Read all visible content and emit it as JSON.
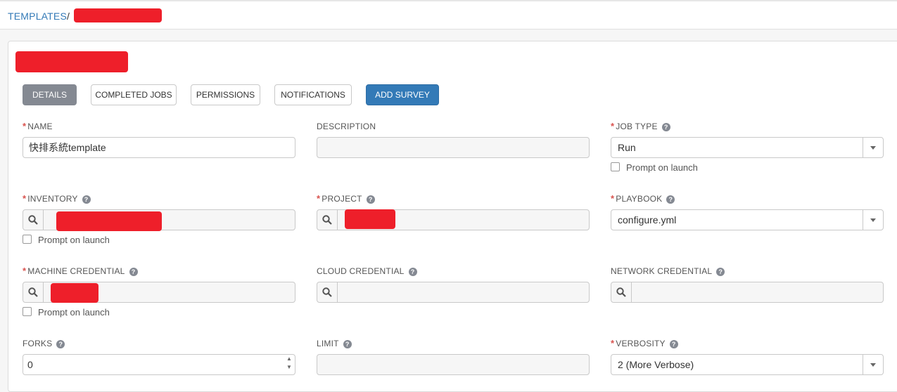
{
  "breadcrumb": {
    "root": "TEMPLATES",
    "separator": "/"
  },
  "tabs": [
    {
      "label": "DETAILS"
    },
    {
      "label": "COMPLETED JOBS"
    },
    {
      "label": "PERMISSIONS"
    },
    {
      "label": "NOTIFICATIONS"
    },
    {
      "label": "ADD SURVEY"
    }
  ],
  "fields": {
    "name": {
      "label": "NAME",
      "value": "快排系統template"
    },
    "description": {
      "label": "DESCRIPTION",
      "value": ""
    },
    "job_type": {
      "label": "JOB TYPE",
      "value": "Run",
      "prompt": "Prompt on launch"
    },
    "inventory": {
      "label": "INVENTORY",
      "prompt": "Prompt on launch"
    },
    "project": {
      "label": "PROJECT"
    },
    "playbook": {
      "label": "PLAYBOOK",
      "value": "configure.yml"
    },
    "machine_credential": {
      "label": "MACHINE CREDENTIAL",
      "prompt": "Prompt on launch"
    },
    "cloud_credential": {
      "label": "CLOUD CREDENTIAL"
    },
    "network_credential": {
      "label": "NETWORK CREDENTIAL"
    },
    "forks": {
      "label": "FORKS",
      "value": "0"
    },
    "limit": {
      "label": "LIMIT",
      "value": ""
    },
    "verbosity": {
      "label": "VERBOSITY",
      "value": "2 (More Verbose)"
    }
  },
  "help_glyph": "?",
  "required_mark": "*",
  "colors": {
    "accent": "#337ab7",
    "active_tab": "#848992",
    "required": "#d9534f",
    "redaction": "#ee1f2a"
  }
}
